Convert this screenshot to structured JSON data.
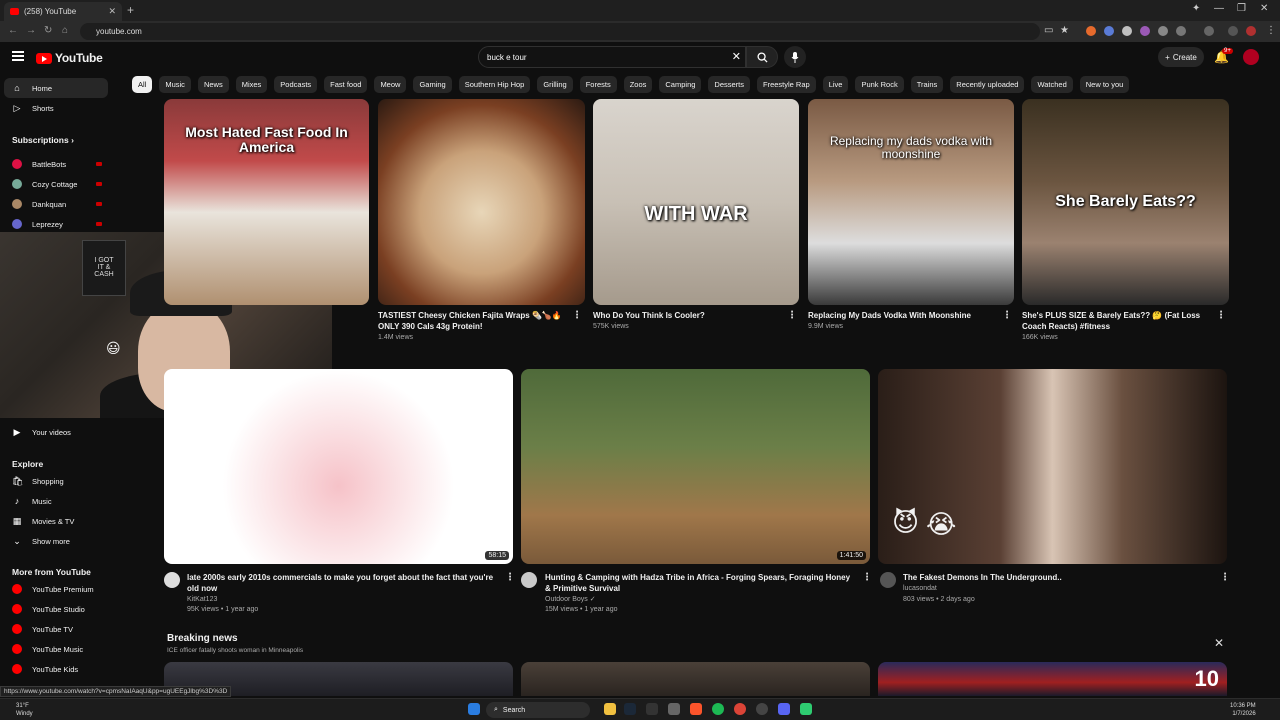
{
  "browser": {
    "tab_title": "(258) YouTube",
    "url": "youtube.com",
    "status_url": "https://www.youtube.com/watch?v=cpmsNaIAaqU&pp=ugUEEgJlbg%3D%3D"
  },
  "header": {
    "logo_text": "YouTube",
    "search_value": "buck e tour",
    "create_label": "Create",
    "notification_count": "9+"
  },
  "chips": [
    "All",
    "Music",
    "News",
    "Mixes",
    "Podcasts",
    "Fast food",
    "Meow",
    "Gaming",
    "Southern Hip Hop",
    "Grilling",
    "Forests",
    "Zoos",
    "Camping",
    "Desserts",
    "Freestyle Rap",
    "Live",
    "Punk Rock",
    "Trains",
    "Recently uploaded",
    "Watched",
    "New to you"
  ],
  "sidebar": {
    "home": "Home",
    "shorts": "Shorts",
    "subscriptions": "Subscriptions",
    "subs": [
      {
        "name": "BattleBots",
        "color": "#d14"
      },
      {
        "name": "Cozy Cottage",
        "color": "#7a9"
      },
      {
        "name": "Dankquan",
        "color": "#a86"
      },
      {
        "name": "Leprezey",
        "color": "#66c"
      }
    ],
    "your_videos": "Your videos",
    "explore": "Explore",
    "explore_items": [
      "Shopping",
      "Music",
      "Movies & TV",
      "Show more"
    ],
    "more_from": "More from YouTube",
    "more_items": [
      "YouTube Premium",
      "YouTube Studio",
      "YouTube TV",
      "YouTube Music",
      "YouTube Kids"
    ]
  },
  "row1": [
    {
      "overlay": "Most Hated Fast Food In America",
      "title": "",
      "meta": ""
    },
    {
      "overlay": "",
      "title": "TASTIEST Cheesy Chicken Fajita Wraps 🌯🍗🔥 ONLY 390 Cals 43g Protein!",
      "meta": "1.4M views"
    },
    {
      "overlay": "WITH WAR",
      "title": "Who Do You Think Is Cooler?",
      "meta": "575K views"
    },
    {
      "overlay": "Replacing my dads vodka with moonshine",
      "title": "Replacing My Dads Vodka With Moonshine",
      "meta": "9.9M views"
    },
    {
      "overlay": "She Barely Eats??",
      "title": "She's PLUS SIZE & Barely Eats?? 🤔 (Fat Loss Coach Reacts) #fitness",
      "meta": "166K views"
    }
  ],
  "row2": [
    {
      "title": "late 2000s early 2010s commercials to make you forget about the fact that you're old now",
      "channel": "KitKat123",
      "meta": "95K views • 1 year ago",
      "duration": "58:15"
    },
    {
      "title": "Hunting & Camping with Hadza Tribe in Africa - Forging Spears, Foraging Honey & Primitive Survival",
      "channel": "Outdoor Boys ✓",
      "meta": "15M views • 1 year ago",
      "duration": "1:41:50"
    },
    {
      "title": "The Fakest Demons In The Underground..",
      "channel": "lucasondat",
      "meta": "803 views • 2 days ago",
      "duration": ""
    }
  ],
  "breaking": {
    "title": "Breaking news",
    "subtitle": "ICE officer fatally shoots woman in Minneapolis"
  },
  "taskbar": {
    "weather_temp": "31°F",
    "weather_desc": "Windy",
    "search_label": "Search",
    "time": "10:36 PM",
    "date": "1/7/2026"
  },
  "colors": {
    "accent": "#ff0000",
    "live": "#cc0000"
  }
}
